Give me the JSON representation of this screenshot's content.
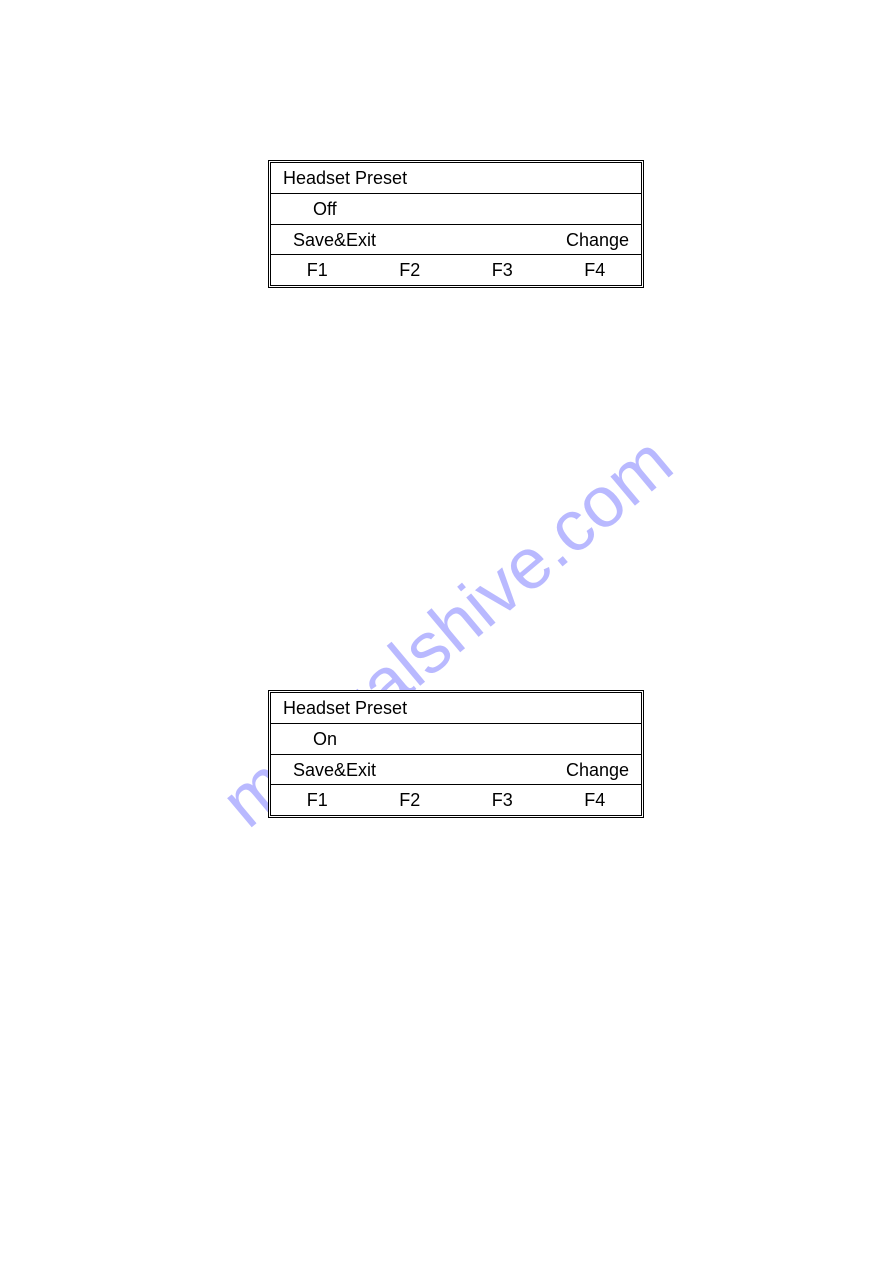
{
  "watermark": "manualshive.com",
  "box1": {
    "title": "Headset Preset",
    "value": "Off",
    "softkeys": {
      "s1": "Save&Exit",
      "s2": "",
      "s3": "",
      "s4": "Change"
    },
    "fkeys": {
      "f1": "F1",
      "f2": "F2",
      "f3": "F3",
      "f4": "F4"
    }
  },
  "box2": {
    "title": "Headset Preset",
    "value": "On",
    "softkeys": {
      "s1": "Save&Exit",
      "s2": "",
      "s3": "",
      "s4": "Change"
    },
    "fkeys": {
      "f1": "F1",
      "f2": "F2",
      "f3": "F3",
      "f4": "F4"
    }
  }
}
